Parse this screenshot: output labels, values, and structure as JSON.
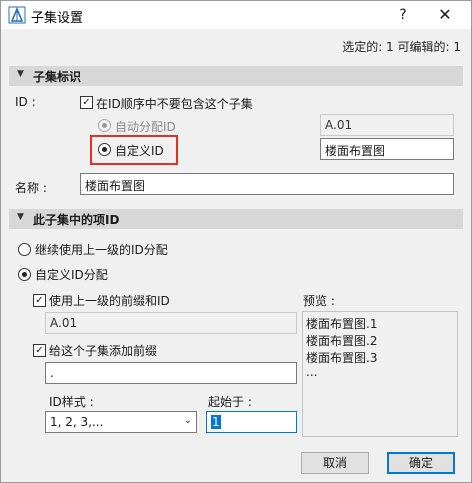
{
  "window": {
    "title": "子集设置",
    "help_label": "?",
    "close_label": "✕",
    "icon": "archicad-app-icon"
  },
  "selection_info": "选定的: 1 可编辑的: 1",
  "section1": {
    "title": "子集标识",
    "id_label": "ID :",
    "exclude_checkbox": {
      "label": "在ID顺序中不要包含这个子集",
      "checked": true
    },
    "auto_radio": {
      "label": "自动分配ID",
      "selected": false,
      "disabled": true
    },
    "custom_radio": {
      "label": "自定义ID",
      "selected": true
    },
    "auto_value": "A.01",
    "custom_value": "楼面布置图",
    "name_label": "名称 :",
    "name_value": "楼面布置图"
  },
  "section2": {
    "title": "此子集中的项ID",
    "inherit_radio": {
      "label": "继续使用上一级的ID分配",
      "selected": false
    },
    "custom_radio": {
      "label": "自定义ID分配",
      "selected": true
    },
    "use_prefix_checkbox": {
      "label": "使用上一级的前缀和ID",
      "checked": true
    },
    "parent_prefix_value": "A.01",
    "add_prefix_checkbox": {
      "label": "给这个子集添加前缀",
      "checked": true
    },
    "prefix_value": ".",
    "style_label": "ID样式 :",
    "style_value": "1, 2, 3,...",
    "start_label": "起始于 :",
    "start_value": "1",
    "preview_label": "预览 :",
    "preview_lines": [
      "楼面布置图.1",
      "楼面布置图.2",
      "楼面布置图.3",
      "..."
    ]
  },
  "buttons": {
    "cancel": "取消",
    "ok": "确定"
  },
  "colors": {
    "highlight": "#e0302a",
    "accent": "#0078d7",
    "section_bg": "#d7d7d7"
  }
}
